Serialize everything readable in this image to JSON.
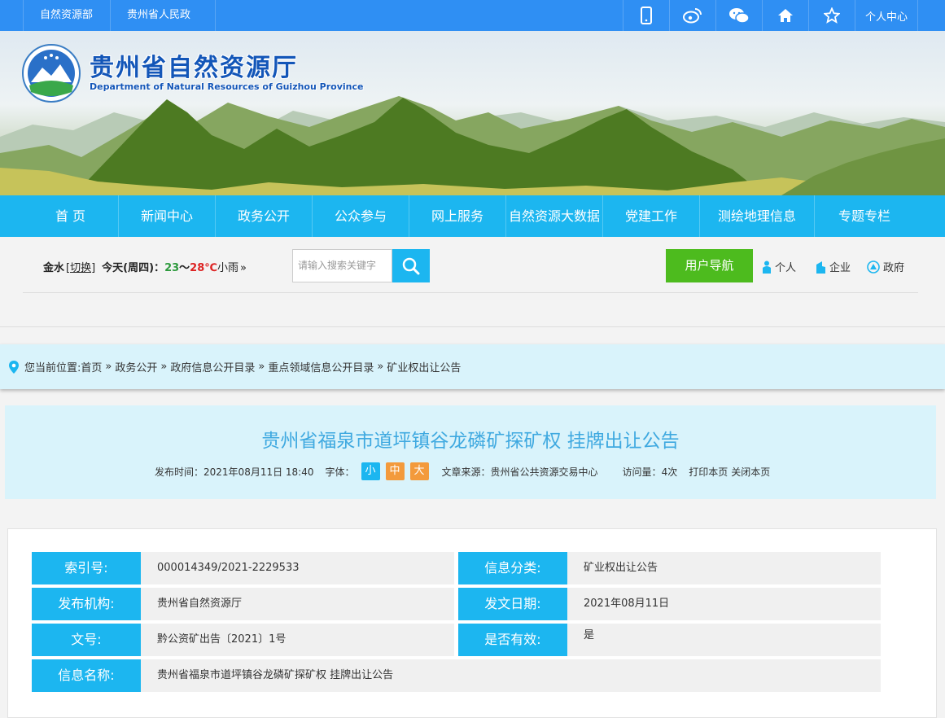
{
  "topbar": {
    "links": [
      "自然资源部",
      "贵州省人民政府"
    ],
    "user_center": "个人中心",
    "icons": [
      "mobile-icon",
      "weibo-icon",
      "wechat-icon",
      "home-icon",
      "star-icon"
    ]
  },
  "banner": {
    "title": "贵州省自然资源厅",
    "subtitle": "Department of Natural Resources of Guizhou Province"
  },
  "nav": [
    "首 页",
    "新闻中心",
    "政务公开",
    "公众参与",
    "网上服务",
    "自然资源大数据",
    "党建工作",
    "测绘地理信息",
    "专题专栏"
  ],
  "weather": {
    "city": "金水",
    "switch": "[切换]",
    "today": "今天(周四)：",
    "low": "23",
    "sep": "～",
    "high": "28℃",
    "desc": "小雨",
    "more": "»"
  },
  "search": {
    "placeholder": "请输入搜索关键字"
  },
  "guide": {
    "label": "用户导航",
    "personal": "个人",
    "enterprise": "企业",
    "government": "政府"
  },
  "breadcrumb": {
    "prefix": "您当前位置:",
    "items": [
      "首页",
      "政务公开",
      "政府信息公开目录",
      "重点领域信息公开目录",
      "矿业权出让公告"
    ],
    "sep": "»"
  },
  "article": {
    "title": "贵州省福泉市道坪镇谷龙磷矿探矿权 挂牌出让公告",
    "publish_label": "发布时间：",
    "publish_time": "2021年08月11日 18:40",
    "font_label": "字体：",
    "font_small": "小",
    "font_mid": "中",
    "font_large": "大",
    "source_label": "文章来源：",
    "source": "贵州省公共资源交易中心",
    "visits_label": "访问量：",
    "visits": "4次",
    "print": "打印本页",
    "close": "关闭本页"
  },
  "info": {
    "index_label": "索引号:",
    "index": "000014349/2021-2229533",
    "category_label": "信息分类:",
    "category": "矿业权出让公告",
    "org_label": "发布机构:",
    "org": "贵州省自然资源厅",
    "date_label": "发文日期:",
    "date": "2021年08月11日",
    "doc_label": "文号:",
    "doc": "黔公资矿出告〔2021〕1号",
    "valid_label": "是否有效:",
    "valid": "是",
    "name_label": "信息名称:",
    "name": "贵州省福泉市道坪镇谷龙磷矿探矿权 挂牌出让公告"
  },
  "colors": {
    "accent": "#1cb6f0",
    "topbar": "#2f8ff3",
    "green": "#4dbb1e",
    "orange": "#f39a3c"
  }
}
